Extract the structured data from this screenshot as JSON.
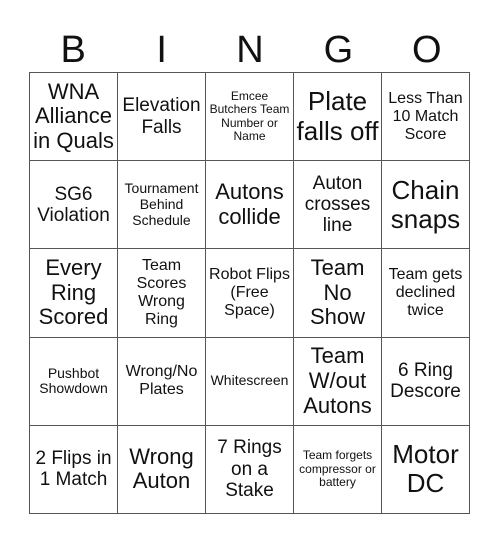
{
  "card": {
    "header_letters": [
      "B",
      "I",
      "N",
      "G",
      "O"
    ],
    "cells": [
      [
        "WNA Alliance in Quals",
        "Elevation Falls",
        "Emcee Butchers Team Number or Name",
        "Plate falls off",
        "Less Than 10 Match Score"
      ],
      [
        "SG6 Violation",
        "Tournament Behind Schedule",
        "Autons collide",
        "Auton crosses line",
        "Chain snaps"
      ],
      [
        "Every Ring Scored",
        "Team Scores Wrong Ring",
        "Robot Flips (Free Space)",
        "Team No Show",
        "Team gets declined twice"
      ],
      [
        "Pushbot Showdown",
        "Wrong/No Plates",
        "Whitescreen",
        "Team W/out Autons",
        "6 Ring Descore"
      ],
      [
        "2 Flips in 1 Match",
        "Wrong Auton",
        "7 Rings on a Stake",
        "Team forgets compressor or battery",
        "Motor DC"
      ]
    ],
    "free_space": "Robot Flips (Free Space)"
  },
  "colors": {
    "text": "#111111",
    "grid_line": "#555555",
    "background": "#ffffff"
  }
}
